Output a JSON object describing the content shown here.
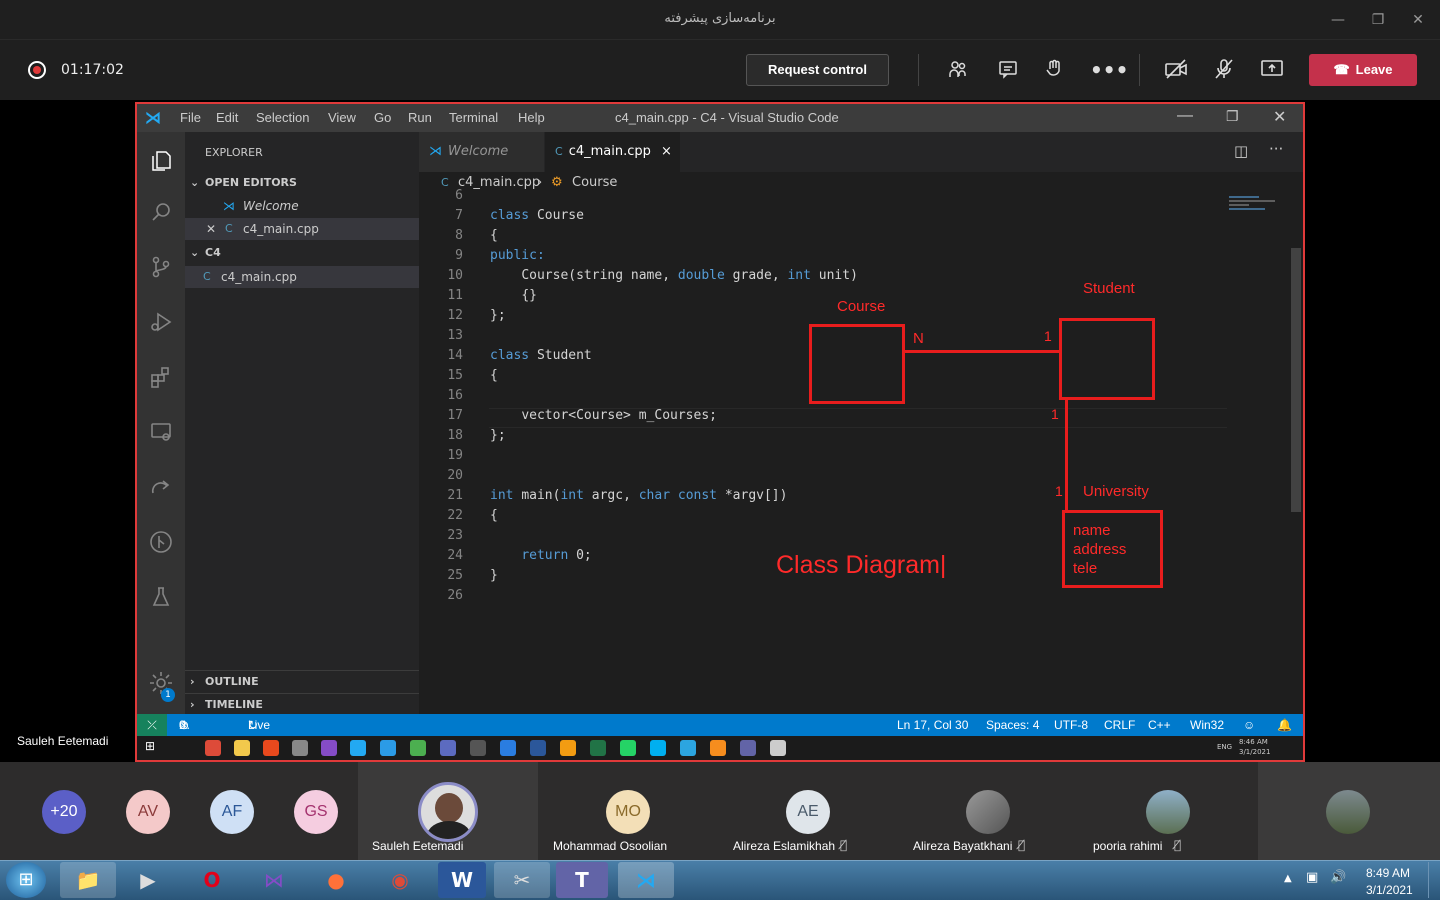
{
  "teams": {
    "window_title": "برنامه‌سازی پیشرفته",
    "timer": "01:17:02",
    "request_control": "Request control",
    "leave": "Leave",
    "presenter_name": "Sauleh Eetemadi"
  },
  "vscode": {
    "menu": [
      "File",
      "Edit",
      "Selection",
      "View",
      "Go",
      "Run",
      "Terminal",
      "Help"
    ],
    "window_title": "c4_main.cpp - C4 - Visual Studio Code",
    "explorer_header": "EXPLORER",
    "open_editors": "OPEN EDITORS",
    "open_editor_items": [
      "Welcome",
      "c4_main.cpp"
    ],
    "folder": "C4",
    "folder_items": [
      "c4_main.cpp"
    ],
    "outline": "OUTLINE",
    "timeline": "TIMELINE",
    "settings_badge": "1",
    "tabs": [
      "Welcome",
      "c4_main.cpp"
    ],
    "tab_close": "×",
    "breadcrumb": [
      "c4_main.cpp",
      "Course"
    ],
    "code_lines": [
      {
        "n": "6",
        "t": ""
      },
      {
        "n": "7",
        "t": "class Course"
      },
      {
        "n": "8",
        "t": "{"
      },
      {
        "n": "9",
        "t": "public:"
      },
      {
        "n": "10",
        "t": "    Course(string name, double grade, int unit)"
      },
      {
        "n": "11",
        "t": "    {}"
      },
      {
        "n": "12",
        "t": "};"
      },
      {
        "n": "13",
        "t": ""
      },
      {
        "n": "14",
        "t": "class Student"
      },
      {
        "n": "15",
        "t": "{"
      },
      {
        "n": "16",
        "t": ""
      },
      {
        "n": "17",
        "t": "    vector<Course> m_Courses;"
      },
      {
        "n": "18",
        "t": "};"
      },
      {
        "n": "19",
        "t": ""
      },
      {
        "n": "20",
        "t": ""
      },
      {
        "n": "21",
        "t": "int main(int argc, char const *argv[])"
      },
      {
        "n": "22",
        "t": "{"
      },
      {
        "n": "23",
        "t": ""
      },
      {
        "n": "24",
        "t": "    return 0;"
      },
      {
        "n": "25",
        "t": "}"
      },
      {
        "n": "26",
        "t": ""
      }
    ],
    "status": {
      "errors": "0",
      "warnings": "0",
      "live_share": "Live Share",
      "position": "Ln 17, Col 30",
      "spaces": "Spaces: 4",
      "encoding": "UTF-8",
      "eol": "CRLF",
      "language": "C++",
      "platform": "Win32"
    },
    "remote_clock": {
      "time": "8:46 AM",
      "date": "3/1/2021",
      "lang": "ENG"
    }
  },
  "diagram": {
    "course_label": "Course",
    "student_label": "Student",
    "university_label": "University",
    "n_label": "N",
    "one_a": "1",
    "one_b": "1",
    "one_c": "1",
    "university_fields": [
      "name",
      "address",
      "tele"
    ],
    "caption": "Class Diagram|"
  },
  "participants": [
    {
      "initials": "+20",
      "name": "",
      "color": "#5b5fc7"
    },
    {
      "initials": "AV",
      "name": "",
      "color": "#f4c9c9"
    },
    {
      "initials": "AF",
      "name": "",
      "color": "#cfe0f5"
    },
    {
      "initials": "GS",
      "name": "",
      "color": "#f5cde0"
    },
    {
      "initials": "",
      "name": "Sauleh Eetemadi",
      "color": "#333"
    },
    {
      "initials": "MO",
      "name": "Mohammad Osoolian",
      "color": "#f3dfb7"
    },
    {
      "initials": "AE",
      "name": "Alireza Eslamikhah",
      "color": "#dfe5ea"
    },
    {
      "initials": "",
      "name": "Alireza Bayatkhani",
      "color": "#888"
    },
    {
      "initials": "",
      "name": "pooria rahimi",
      "color": "#6b8aa0"
    }
  ],
  "taskbar": {
    "time": "8:49 AM",
    "date": "3/1/2021"
  }
}
